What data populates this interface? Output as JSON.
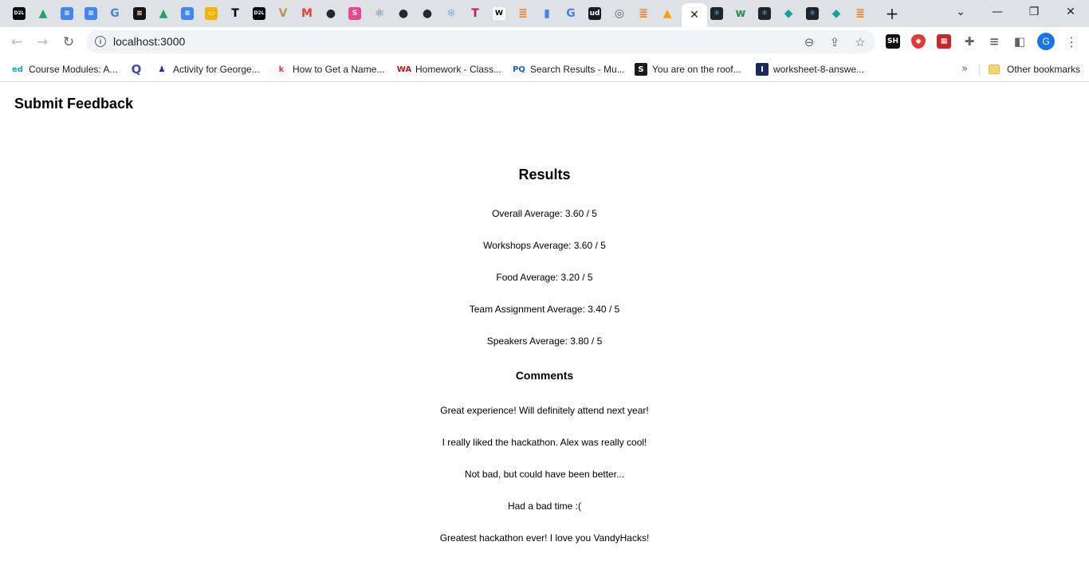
{
  "browser": {
    "tabs": [
      {
        "icon": "d2l-icon",
        "glyph": "D2L",
        "bg": "#000000",
        "fg": "#ffffff"
      },
      {
        "icon": "google-drive-icon",
        "glyph": "▲",
        "bg": "transparent",
        "fg": "#1fa463"
      },
      {
        "icon": "google-docs-icon",
        "glyph": "≡",
        "bg": "#4285f4",
        "fg": "#ffffff"
      },
      {
        "icon": "google-docs-icon",
        "glyph": "≡",
        "bg": "#4285f4",
        "fg": "#ffffff"
      },
      {
        "icon": "google-icon",
        "glyph": "G",
        "bg": "transparent",
        "fg": "#4285f4"
      },
      {
        "icon": "spotify-icon",
        "glyph": "≋",
        "bg": "#191414",
        "fg": "#ffffff"
      },
      {
        "icon": "google-drive-icon",
        "glyph": "▲",
        "bg": "transparent",
        "fg": "#1fa463"
      },
      {
        "icon": "google-docs-icon",
        "glyph": "≡",
        "bg": "#4285f4",
        "fg": "#ffffff"
      },
      {
        "icon": "google-slides-icon",
        "glyph": "▭",
        "bg": "#f4b400",
        "fg": "#ffffff"
      },
      {
        "icon": "nytimes-icon",
        "glyph": "T",
        "bg": "transparent",
        "fg": "#000000"
      },
      {
        "icon": "d2l-icon",
        "glyph": "D2L",
        "bg": "#000000",
        "fg": "#ffffff"
      },
      {
        "icon": "vanderbilt-icon",
        "glyph": "V",
        "bg": "transparent",
        "fg": "#b49650"
      },
      {
        "icon": "gmail-icon",
        "glyph": "M",
        "bg": "transparent",
        "fg": "#ea4335"
      },
      {
        "icon": "github-icon",
        "glyph": "●",
        "bg": "transparent",
        "fg": "#24292e"
      },
      {
        "icon": "s-icon",
        "glyph": "S",
        "bg": "#e8488b",
        "fg": "#ffffff"
      },
      {
        "icon": "react-icon",
        "glyph": "⚛",
        "bg": "transparent",
        "fg": "#3b6fa0"
      },
      {
        "icon": "github-icon",
        "glyph": "●",
        "bg": "transparent",
        "fg": "#24292e"
      },
      {
        "icon": "github-icon",
        "glyph": "●",
        "bg": "transparent",
        "fg": "#24292e"
      },
      {
        "icon": "snowflake-icon",
        "glyph": "❄",
        "bg": "transparent",
        "fg": "#8ab4d6"
      },
      {
        "icon": "t-icon",
        "glyph": "T",
        "bg": "transparent",
        "fg": "#c2185b"
      },
      {
        "icon": "wikipedia-icon",
        "glyph": "W",
        "bg": "#ffffff",
        "fg": "#000000"
      },
      {
        "icon": "stackoverflow-icon",
        "glyph": "≣",
        "bg": "transparent",
        "fg": "#f48024"
      },
      {
        "icon": "analytics-icon",
        "glyph": "▮",
        "bg": "transparent",
        "fg": "#4285f4"
      },
      {
        "icon": "google-icon",
        "glyph": "G",
        "bg": "transparent",
        "fg": "#4285f4"
      },
      {
        "icon": "udacity-icon",
        "glyph": "ud",
        "bg": "#1a1a1a",
        "fg": "#ffffff"
      },
      {
        "icon": "chrome-icon",
        "glyph": "◎",
        "bg": "transparent",
        "fg": "#5f6368"
      },
      {
        "icon": "stackoverflow-icon",
        "glyph": "≣",
        "bg": "transparent",
        "fg": "#f48024"
      },
      {
        "icon": "firebase-icon",
        "glyph": "▲",
        "bg": "transparent",
        "fg": "#ffa000"
      },
      {
        "icon": "react-icon",
        "glyph": "⚛",
        "bg": "#20232a",
        "fg": "#61dafb"
      },
      {
        "icon": "w-icon",
        "glyph": "w",
        "bg": "transparent",
        "fg": "#2e8b57"
      },
      {
        "icon": "react-icon",
        "glyph": "⚛",
        "bg": "#20232a",
        "fg": "#61dafb"
      },
      {
        "icon": "diamond-icon",
        "glyph": "◆",
        "bg": "transparent",
        "fg": "#1a9e9e"
      },
      {
        "icon": "react-icon",
        "glyph": "⚛",
        "bg": "#20232a",
        "fg": "#61dafb"
      },
      {
        "icon": "diamond-icon",
        "glyph": "◆",
        "bg": "transparent",
        "fg": "#1a9e9e"
      },
      {
        "icon": "stackoverflow-icon",
        "glyph": "≣",
        "bg": "transparent",
        "fg": "#f48024"
      }
    ],
    "url": "localhost:3000",
    "bookmarks": [
      {
        "label": "Course Modules: A...",
        "icon": "ed-icon",
        "glyph": "ed",
        "fg": "#0ea5c6"
      },
      {
        "label": "",
        "icon": "quizlet-icon",
        "glyph": "Q",
        "fg": "#3b4aa3"
      },
      {
        "label": "Activity for George...",
        "icon": "person-icon",
        "glyph": "♟",
        "fg": "#4b1a8c"
      },
      {
        "label": "How to Get a Name...",
        "icon": "k-icon",
        "glyph": "k",
        "fg": "#e53935"
      },
      {
        "label": "Homework - Class...",
        "icon": "webassign-icon",
        "glyph": "WA",
        "fg": "#b71c1c"
      },
      {
        "label": "Search Results - Mu...",
        "icon": "pq-icon",
        "glyph": "PQ",
        "fg": "#1565c0"
      },
      {
        "label": "You are on the roof...",
        "icon": "s-icon",
        "glyph": "S",
        "fg": "#ffffff",
        "bg": "#1b1b1b"
      },
      {
        "label": "worksheet-8-answe...",
        "icon": "i-icon",
        "glyph": "I",
        "fg": "#ffffff",
        "bg": "#1b2a5e"
      }
    ],
    "other_bookmarks": "Other bookmarks"
  },
  "page": {
    "title": "Submit Feedback",
    "results_title": "Results",
    "metrics": [
      {
        "label": "Overall Average: 3.60 / 5"
      },
      {
        "label": "Workshops Average: 3.60 / 5"
      },
      {
        "label": "Food Average: 3.20 / 5"
      },
      {
        "label": "Team Assignment Average: 3.40 / 5"
      },
      {
        "label": "Speakers Average: 3.80 / 5"
      }
    ],
    "comments_title": "Comments",
    "comments": [
      "Great experience! Will definitely attend next year!",
      "I really liked the hackathon. Alex was really cool!",
      "Not bad, but could have been better...",
      "Had a bad time :(",
      "Greatest hackathon ever! I love you VandyHacks!"
    ]
  }
}
